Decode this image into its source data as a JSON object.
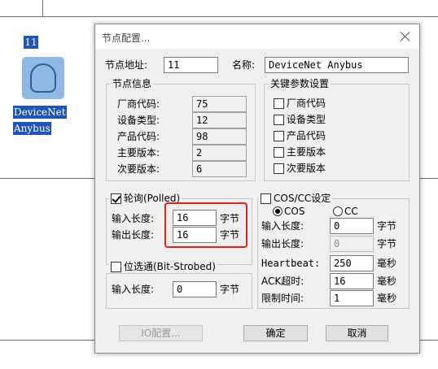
{
  "canvas": {
    "node_address": "11",
    "node_name_line1": "DeviceNet",
    "node_name_line2": "Anybus",
    "node_icon": "device-icon"
  },
  "dialog": {
    "title": "节点配置...",
    "close_icon": "close-icon",
    "node_address_label": "节点地址:",
    "node_address_value": "11",
    "name_label": "名称:",
    "name_value": "DeviceNet Anybus",
    "node_info": {
      "title": "节点信息",
      "rows": [
        {
          "label": "厂商代码:",
          "value": "75"
        },
        {
          "label": "设备类型:",
          "value": "12"
        },
        {
          "label": "产品代码:",
          "value": "98"
        },
        {
          "label": "主要版本:",
          "value": "2"
        },
        {
          "label": "次要版本:",
          "value": "6"
        }
      ]
    },
    "key_params": {
      "title": "关键参数设置",
      "items": [
        {
          "label": "厂商代码",
          "checked": false
        },
        {
          "label": "设备类型",
          "checked": false
        },
        {
          "label": "产品代码",
          "checked": false
        },
        {
          "label": "主要版本",
          "checked": false
        },
        {
          "label": "次要版本",
          "checked": false
        }
      ]
    },
    "polled": {
      "label": "轮询(Polled)",
      "checked": true,
      "input_length_label": "输入长度:",
      "input_length_value": "16",
      "output_length_label": "输出长度:",
      "output_length_value": "16",
      "unit": "字节"
    },
    "bit_strobed": {
      "label": "位选通(Bit-Strobed)",
      "checked": false,
      "input_length_label": "输入长度:",
      "input_length_value": "0",
      "unit": "字节"
    },
    "cos": {
      "label": "COS/CC设定",
      "checked": false,
      "radio_cos": "COS",
      "radio_cc": "CC",
      "selected": "COS",
      "input_length_label": "输入长度:",
      "input_length_value": "0",
      "output_length_label": "输出长度:",
      "output_length_value": "0",
      "byte_unit": "字节",
      "heartbeat_label": "Heartbeat:",
      "heartbeat_value": "250",
      "ack_label": "ACK超时:",
      "ack_value": "16",
      "limit_label": "限制时间:",
      "limit_value": "1",
      "ms_unit": "毫秒"
    },
    "buttons": {
      "io_config": "IO配置...",
      "ok": "确定",
      "cancel": "取消"
    },
    "highlight_color": "#e32219"
  }
}
